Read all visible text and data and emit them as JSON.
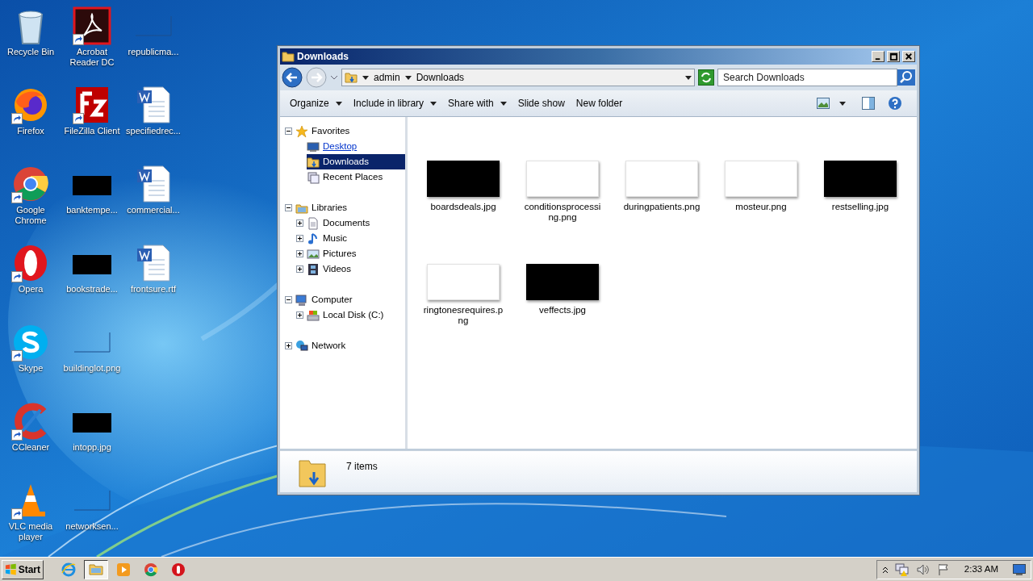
{
  "desktop": {
    "columns": [
      [
        {
          "label": "Recycle Bin",
          "kind": "recycle",
          "shortcut": false
        },
        {
          "label": "Firefox",
          "kind": "firefox",
          "shortcut": true
        },
        {
          "label": "Google Chrome",
          "kind": "chrome",
          "shortcut": true
        },
        {
          "label": "Opera",
          "kind": "opera",
          "shortcut": true
        },
        {
          "label": "Skype",
          "kind": "skype",
          "shortcut": true
        },
        {
          "label": "CCleaner",
          "kind": "ccleaner",
          "shortcut": true
        },
        {
          "label": "VLC media player",
          "kind": "vlc",
          "shortcut": true
        }
      ],
      [
        {
          "label": "Acrobat Reader DC",
          "kind": "acrobat",
          "shortcut": true
        },
        {
          "label": "FileZilla Client",
          "kind": "filezilla",
          "shortcut": true
        },
        {
          "label": "banktempe...",
          "kind": "dark",
          "shortcut": false
        },
        {
          "label": "bookstrade...",
          "kind": "dark",
          "shortcut": false
        },
        {
          "label": "buildinglot.png",
          "kind": "blank",
          "shortcut": false
        },
        {
          "label": "intopp.jpg",
          "kind": "dark",
          "shortcut": false
        },
        {
          "label": "networksen...",
          "kind": "blank",
          "shortcut": false
        }
      ],
      [
        {
          "label": "republicma...",
          "kind": "blank",
          "shortcut": false
        },
        {
          "label": "specifiedrec...",
          "kind": "word",
          "shortcut": false
        },
        {
          "label": "commercial...",
          "kind": "word",
          "shortcut": false
        },
        {
          "label": "frontsure.rtf",
          "kind": "word",
          "shortcut": false
        }
      ]
    ]
  },
  "window": {
    "title": "Downloads",
    "address": {
      "crumbs": [
        "admin",
        "Downloads"
      ]
    },
    "search": {
      "placeholder": "Search Downloads"
    },
    "toolbar": [
      {
        "label": "Organize",
        "menu": true
      },
      {
        "label": "Include in library",
        "menu": true
      },
      {
        "label": "Share with",
        "menu": true
      },
      {
        "label": "Slide show",
        "menu": false
      },
      {
        "label": "New folder",
        "menu": false
      }
    ],
    "nav": [
      {
        "label": "Favorites",
        "kind": "star",
        "expanded": true,
        "selected": false,
        "children": [
          {
            "label": "Desktop",
            "kind": "desktop",
            "selected": false,
            "hovered": true
          },
          {
            "label": "Downloads",
            "kind": "downloads",
            "selected": true,
            "hovered": false
          },
          {
            "label": "Recent Places",
            "kind": "recent",
            "selected": false,
            "hovered": false
          }
        ]
      },
      {
        "label": "Libraries",
        "kind": "libraries",
        "expanded": true,
        "selected": false,
        "children": [
          {
            "label": "Documents",
            "kind": "documents",
            "selected": false,
            "expanded": false
          },
          {
            "label": "Music",
            "kind": "music",
            "selected": false,
            "expanded": false
          },
          {
            "label": "Pictures",
            "kind": "pictures",
            "selected": false,
            "expanded": false
          },
          {
            "label": "Videos",
            "kind": "videos",
            "selected": false,
            "expanded": false
          }
        ]
      },
      {
        "label": "Computer",
        "kind": "computer",
        "expanded": true,
        "selected": false,
        "children": [
          {
            "label": "Local Disk (C:)",
            "kind": "disk",
            "selected": false,
            "expanded": false
          }
        ]
      },
      {
        "label": "Network",
        "kind": "network",
        "expanded": false,
        "selected": false
      }
    ],
    "files": [
      {
        "name": "boardsdeals.jpg",
        "kind": "dark"
      },
      {
        "name": "conditionsprocessing.png",
        "kind": "light"
      },
      {
        "name": "duringpatients.png",
        "kind": "light"
      },
      {
        "name": "mosteur.png",
        "kind": "light"
      },
      {
        "name": "restselling.jpg",
        "kind": "dark"
      },
      {
        "name": "ringtonesrequires.png",
        "kind": "light"
      },
      {
        "name": "veffects.jpg",
        "kind": "dark"
      }
    ],
    "status": "7 items"
  },
  "taskbar": {
    "start": "Start",
    "apps": [
      {
        "kind": "ie",
        "selected": false
      },
      {
        "kind": "explorer",
        "selected": true
      },
      {
        "kind": "media",
        "selected": false
      },
      {
        "kind": "chrome",
        "selected": false
      },
      {
        "kind": "opera",
        "selected": false
      }
    ],
    "clock": "2:33 AM"
  }
}
